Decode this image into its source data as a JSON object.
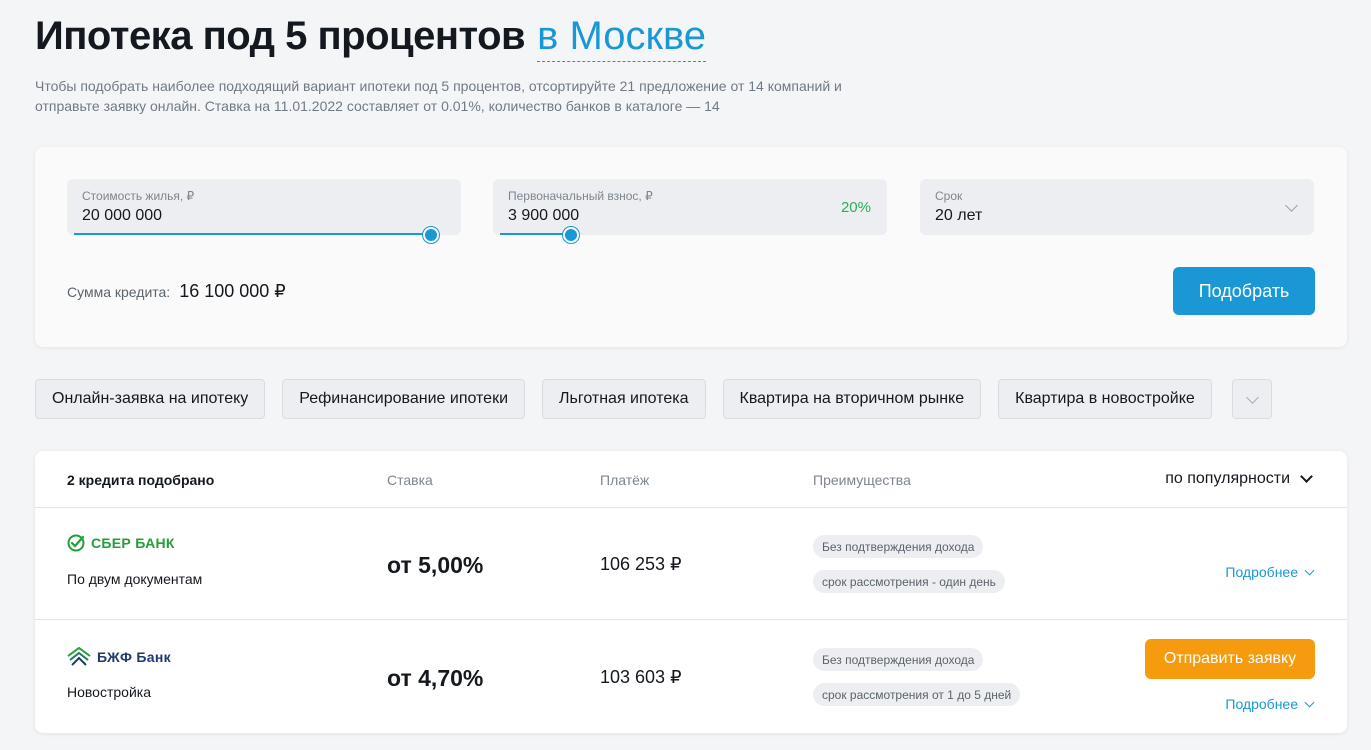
{
  "header": {
    "title": "Ипотека под 5 процентов",
    "city": "в Москве",
    "description": "Чтобы подобрать наиболее подходящий вариант ипотеки под 5 процентов, отсортируйте 21 предложение от 14 компаний и отправьте заявку онлайн. Ставка на 11.01.2022 составляет от 0.01%, количество банков в каталоге — 14"
  },
  "calculator": {
    "price": {
      "label": "Стоимость жилья, ₽",
      "value": "20 000 000",
      "slider_fraction": 1.0
    },
    "down_payment": {
      "label": "Первоначальный взнос, ₽",
      "value": "3 900 000",
      "percent": "20%",
      "slider_fraction": 0.2
    },
    "term": {
      "label": "Срок",
      "value": "20 лет"
    },
    "loan_sum_label": "Сумма кредита:",
    "loan_sum_value": "16 100 000 ₽",
    "submit_label": "Подобрать"
  },
  "filters": [
    "Онлайн-заявка на ипотеку",
    "Рефинансирование ипотеки",
    "Льготная ипотека",
    "Квартира на вторичном рынке",
    "Квартира в новостройке"
  ],
  "results": {
    "count": "2 кредита подобрано",
    "col_rate": "Ставка",
    "col_payment": "Платёж",
    "col_benefits": "Преимущества",
    "sort_label": "по популярности",
    "offers": [
      {
        "bank": "СБЕР БАНК",
        "program": "По двум документам",
        "rate": "от 5,00%",
        "payment": "106 253 ₽",
        "tags": [
          "Без подтверждения дохода",
          "срок рассмотрения - один день"
        ],
        "more": "Подробнее"
      },
      {
        "bank": "БЖФ Банк",
        "program": "Новостройка",
        "rate": "от 4,70%",
        "payment": "103 603 ₽",
        "tags": [
          "Без подтверждения дохода",
          "срок рассмотрения от 1 до 5 дней"
        ],
        "apply": "Отправить заявку",
        "more": "Подробнее"
      }
    ]
  },
  "colors": {
    "accent": "#1a98d5",
    "apply": "#f59b0d",
    "percent_green": "#2eac57",
    "sber_green": "#21a038",
    "bjf_navy": "#1e3a6e"
  }
}
